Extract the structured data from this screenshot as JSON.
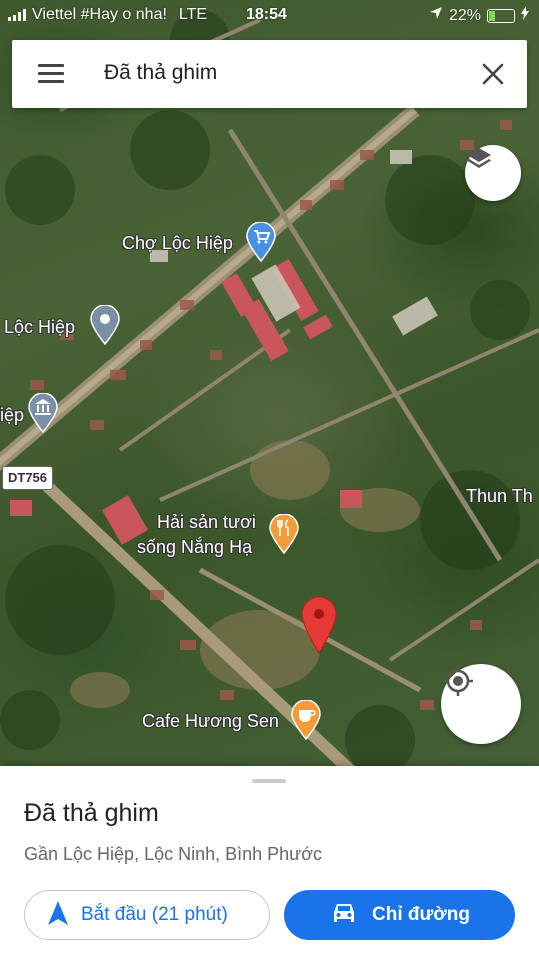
{
  "status_bar": {
    "carrier": "Viettel #Hay o nha!",
    "network": "LTE",
    "time": "18:54",
    "battery": "22%"
  },
  "search": {
    "text": "Đã thả ghim"
  },
  "map_labels": {
    "cho_loc_hiep": "Chợ Lộc Hiệp",
    "loc_hiep": "Lộc Hiệp",
    "hiep_partial": "iệp",
    "road": "DT756",
    "thun_partial": "Thun Th",
    "hai_san_line1": "Hải sản tươi",
    "hai_san_line2": "sống Nắng Hạ",
    "cafe": "Cafe Hương Sen"
  },
  "sheet": {
    "title": "Đã thả ghim",
    "subtitle": "Gần Lộc Hiệp, Lộc Ninh, Bình Phước",
    "start_label": "Bắt đầu (21 phút)",
    "directions_label": "Chỉ đường"
  },
  "colors": {
    "accent": "#1a73e8",
    "pin": "#e53935",
    "poi_blue": "#4a90e2",
    "poi_orange": "#f29b38",
    "poi_gray": "#7a8fa6"
  }
}
